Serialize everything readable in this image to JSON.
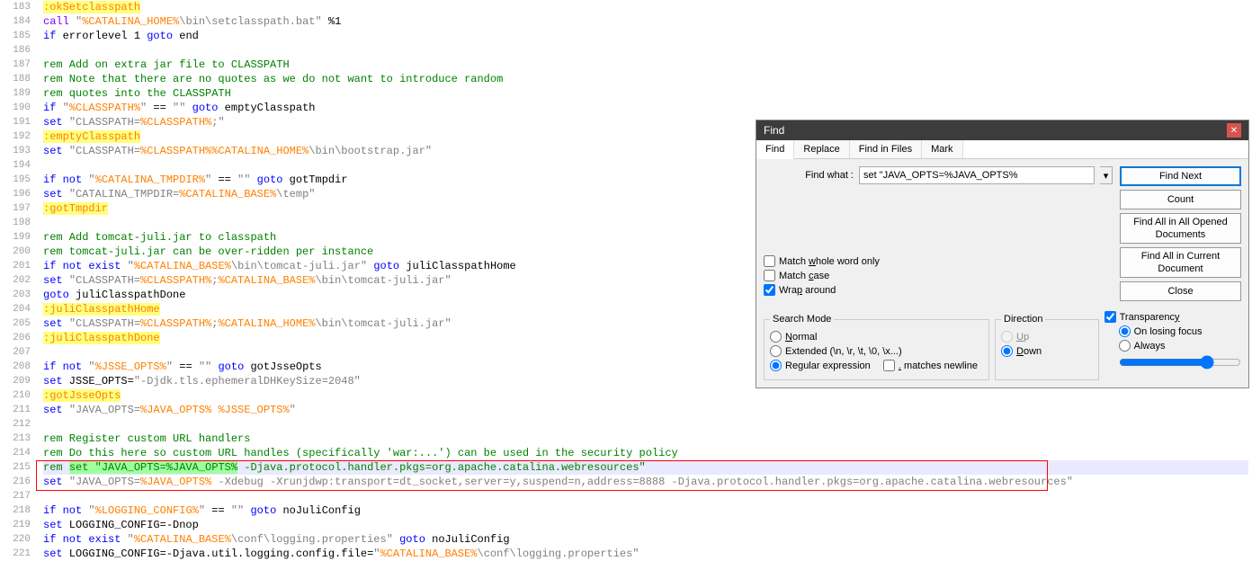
{
  "lines": {
    "183": [
      {
        "t": ":okSetclasspath",
        "c": "t-orange hl-yellow"
      }
    ],
    "184": [
      {
        "t": "call",
        "c": "t-purple"
      },
      {
        "t": " ",
        "c": ""
      },
      {
        "t": "\"",
        "c": "t-gray"
      },
      {
        "t": "%CATALINA_HOME%",
        "c": "t-orange"
      },
      {
        "t": "\\bin\\setclasspath.bat\"",
        "c": "t-gray"
      },
      {
        "t": " %1",
        "c": ""
      }
    ],
    "185": [
      {
        "t": "if",
        "c": "t-blue"
      },
      {
        "t": " errorlevel 1 ",
        "c": ""
      },
      {
        "t": "goto",
        "c": "t-blue"
      },
      {
        "t": " end",
        "c": ""
      }
    ],
    "186": [
      {
        "t": "",
        "c": ""
      }
    ],
    "187": [
      {
        "t": "rem Add on extra jar file to CLASSPATH",
        "c": "t-green"
      }
    ],
    "188": [
      {
        "t": "rem Note that there are no quotes as we do not want to introduce random",
        "c": "t-green"
      }
    ],
    "189": [
      {
        "t": "rem quotes into the CLASSPATH",
        "c": "t-green"
      }
    ],
    "190": [
      {
        "t": "if",
        "c": "t-blue"
      },
      {
        "t": " ",
        "c": ""
      },
      {
        "t": "\"",
        "c": "t-gray"
      },
      {
        "t": "%CLASSPATH%",
        "c": "t-orange"
      },
      {
        "t": "\"",
        "c": "t-gray"
      },
      {
        "t": " == ",
        "c": ""
      },
      {
        "t": "\"\"",
        "c": "t-gray"
      },
      {
        "t": " ",
        "c": ""
      },
      {
        "t": "goto",
        "c": "t-blue"
      },
      {
        "t": " emptyClasspath",
        "c": ""
      }
    ],
    "191": [
      {
        "t": "set",
        "c": "t-blue"
      },
      {
        "t": " ",
        "c": ""
      },
      {
        "t": "\"CLASSPATH=",
        "c": "t-gray"
      },
      {
        "t": "%CLASSPATH%",
        "c": "t-orange"
      },
      {
        "t": ";\"",
        "c": "t-gray"
      }
    ],
    "192": [
      {
        "t": ":emptyClasspath",
        "c": "t-orange hl-yellow"
      }
    ],
    "193": [
      {
        "t": "set",
        "c": "t-blue"
      },
      {
        "t": " ",
        "c": ""
      },
      {
        "t": "\"CLASSPATH=",
        "c": "t-gray"
      },
      {
        "t": "%CLASSPATH%%CATALINA_HOME%",
        "c": "t-orange"
      },
      {
        "t": "\\bin\\bootstrap.jar\"",
        "c": "t-gray"
      }
    ],
    "194": [
      {
        "t": "",
        "c": ""
      }
    ],
    "195": [
      {
        "t": "if",
        "c": "t-blue"
      },
      {
        "t": " ",
        "c": ""
      },
      {
        "t": "not",
        "c": "t-blue"
      },
      {
        "t": " ",
        "c": ""
      },
      {
        "t": "\"",
        "c": "t-gray"
      },
      {
        "t": "%CATALINA_TMPDIR%",
        "c": "t-orange"
      },
      {
        "t": "\"",
        "c": "t-gray"
      },
      {
        "t": " == ",
        "c": ""
      },
      {
        "t": "\"\"",
        "c": "t-gray"
      },
      {
        "t": " ",
        "c": ""
      },
      {
        "t": "goto",
        "c": "t-blue"
      },
      {
        "t": " gotTmpdir",
        "c": ""
      }
    ],
    "196": [
      {
        "t": "set",
        "c": "t-blue"
      },
      {
        "t": " ",
        "c": ""
      },
      {
        "t": "\"CATALINA_TMPDIR=",
        "c": "t-gray"
      },
      {
        "t": "%CATALINA_BASE%",
        "c": "t-orange"
      },
      {
        "t": "\\temp\"",
        "c": "t-gray"
      }
    ],
    "197": [
      {
        "t": ":gotTmpdir",
        "c": "t-orange hl-yellow"
      }
    ],
    "198": [
      {
        "t": "",
        "c": ""
      }
    ],
    "199": [
      {
        "t": "rem Add tomcat-juli.jar to classpath",
        "c": "t-green"
      }
    ],
    "200": [
      {
        "t": "rem tomcat-juli.jar can be over-ridden per instance",
        "c": "t-green"
      }
    ],
    "201": [
      {
        "t": "if",
        "c": "t-blue"
      },
      {
        "t": " ",
        "c": ""
      },
      {
        "t": "not",
        "c": "t-blue"
      },
      {
        "t": " ",
        "c": ""
      },
      {
        "t": "exist",
        "c": "t-blue"
      },
      {
        "t": " ",
        "c": ""
      },
      {
        "t": "\"",
        "c": "t-gray"
      },
      {
        "t": "%CATALINA_BASE%",
        "c": "t-orange"
      },
      {
        "t": "\\bin\\tomcat-juli.jar\"",
        "c": "t-gray"
      },
      {
        "t": " ",
        "c": ""
      },
      {
        "t": "goto",
        "c": "t-blue"
      },
      {
        "t": " juliClasspathHome",
        "c": ""
      }
    ],
    "202": [
      {
        "t": "set",
        "c": "t-blue"
      },
      {
        "t": " ",
        "c": ""
      },
      {
        "t": "\"CLASSPATH=",
        "c": "t-gray"
      },
      {
        "t": "%CLASSPATH%",
        "c": "t-orange"
      },
      {
        "t": ";",
        "c": "t-gray"
      },
      {
        "t": "%CATALINA_BASE%",
        "c": "t-orange"
      },
      {
        "t": "\\bin\\tomcat-juli.jar\"",
        "c": "t-gray"
      }
    ],
    "203": [
      {
        "t": "goto",
        "c": "t-blue"
      },
      {
        "t": " juliClasspathDone",
        "c": ""
      }
    ],
    "204": [
      {
        "t": ":juliClasspathHome",
        "c": "t-orange hl-yellow"
      }
    ],
    "205": [
      {
        "t": "set",
        "c": "t-blue"
      },
      {
        "t": " ",
        "c": ""
      },
      {
        "t": "\"CLASSPATH=",
        "c": "t-gray"
      },
      {
        "t": "%CLASSPATH%",
        "c": "t-orange"
      },
      {
        "t": ";",
        "c": "t-gray"
      },
      {
        "t": "%CATALINA_HOME%",
        "c": "t-orange"
      },
      {
        "t": "\\bin\\tomcat-juli.jar\"",
        "c": "t-gray"
      }
    ],
    "206": [
      {
        "t": ":juliClasspathDone",
        "c": "t-orange hl-yellow"
      }
    ],
    "207": [
      {
        "t": "",
        "c": ""
      }
    ],
    "208": [
      {
        "t": "if",
        "c": "t-blue"
      },
      {
        "t": " ",
        "c": ""
      },
      {
        "t": "not",
        "c": "t-blue"
      },
      {
        "t": " ",
        "c": ""
      },
      {
        "t": "\"",
        "c": "t-gray"
      },
      {
        "t": "%JSSE_OPTS%",
        "c": "t-orange"
      },
      {
        "t": "\"",
        "c": "t-gray"
      },
      {
        "t": " == ",
        "c": ""
      },
      {
        "t": "\"\"",
        "c": "t-gray"
      },
      {
        "t": " ",
        "c": ""
      },
      {
        "t": "goto",
        "c": "t-blue"
      },
      {
        "t": " gotJsseOpts",
        "c": ""
      }
    ],
    "209": [
      {
        "t": "set",
        "c": "t-blue"
      },
      {
        "t": " JSSE_OPTS=",
        "c": ""
      },
      {
        "t": "\"-Djdk.tls.ephemeralDHKeySize=2048\"",
        "c": "t-gray"
      }
    ],
    "210": [
      {
        "t": ":gotJsseOpts",
        "c": "t-orange hl-yellow"
      }
    ],
    "211": [
      {
        "t": "set",
        "c": "t-blue"
      },
      {
        "t": " ",
        "c": ""
      },
      {
        "t": "\"JAVA_OPTS=",
        "c": "t-gray"
      },
      {
        "t": "%JAVA_OPTS% %JSSE_OPTS%",
        "c": "t-orange"
      },
      {
        "t": "\"",
        "c": "t-gray"
      }
    ],
    "212": [
      {
        "t": "",
        "c": ""
      }
    ],
    "213": [
      {
        "t": "rem Register custom URL handlers",
        "c": "t-green"
      }
    ],
    "214": [
      {
        "t": "rem Do this here so custom URL handles (specifically 'war:...') can be used in the security policy",
        "c": "t-green"
      }
    ],
    "215": [
      {
        "t": "rem ",
        "c": "t-green"
      },
      {
        "t": "set \"JAVA_OPTS=%JAVA_OPTS%",
        "c": "t-green hl-green"
      },
      {
        "t": " -Djava.protocol.handler.pkgs=org.apache.catalina.webresources\"",
        "c": "t-green"
      }
    ],
    "216": [
      {
        "t": "set",
        "c": "t-blue"
      },
      {
        "t": " ",
        "c": ""
      },
      {
        "t": "\"JAVA_OPTS=",
        "c": "t-gray"
      },
      {
        "t": "%JAVA_OPTS%",
        "c": "t-orange"
      },
      {
        "t": " -Xdebug -Xrunjdwp:transport=dt_socket,server=y,suspend=n,address=8888 -Djava.protocol.handler.pkgs=org.apache.catalina.webresources\"",
        "c": "t-gray"
      }
    ],
    "217": [
      {
        "t": "",
        "c": ""
      }
    ],
    "218": [
      {
        "t": "if",
        "c": "t-blue"
      },
      {
        "t": " ",
        "c": ""
      },
      {
        "t": "not",
        "c": "t-blue"
      },
      {
        "t": " ",
        "c": ""
      },
      {
        "t": "\"",
        "c": "t-gray"
      },
      {
        "t": "%LOGGING_CONFIG%",
        "c": "t-orange"
      },
      {
        "t": "\"",
        "c": "t-gray"
      },
      {
        "t": " == ",
        "c": ""
      },
      {
        "t": "\"\"",
        "c": "t-gray"
      },
      {
        "t": " ",
        "c": ""
      },
      {
        "t": "goto",
        "c": "t-blue"
      },
      {
        "t": " noJuliConfig",
        "c": ""
      }
    ],
    "219": [
      {
        "t": "set",
        "c": "t-blue"
      },
      {
        "t": " LOGGING_CONFIG=-Dnop",
        "c": ""
      }
    ],
    "220": [
      {
        "t": "if",
        "c": "t-blue"
      },
      {
        "t": " ",
        "c": ""
      },
      {
        "t": "not",
        "c": "t-blue"
      },
      {
        "t": " ",
        "c": ""
      },
      {
        "t": "exist",
        "c": "t-blue"
      },
      {
        "t": " ",
        "c": ""
      },
      {
        "t": "\"",
        "c": "t-gray"
      },
      {
        "t": "%CATALINA_BASE%",
        "c": "t-orange"
      },
      {
        "t": "\\conf\\logging.properties\"",
        "c": "t-gray"
      },
      {
        "t": " ",
        "c": ""
      },
      {
        "t": "goto",
        "c": "t-blue"
      },
      {
        "t": " noJuliConfig",
        "c": ""
      }
    ],
    "221": [
      {
        "t": "set",
        "c": "t-blue"
      },
      {
        "t": " LOGGING_CONFIG=-Djava.util.logging.config.file=",
        "c": ""
      },
      {
        "t": "\"",
        "c": "t-gray"
      },
      {
        "t": "%CATALINA_BASE%",
        "c": "t-orange"
      },
      {
        "t": "\\conf\\logging.properties\"",
        "c": "t-gray"
      }
    ]
  },
  "start": 183,
  "end": 221,
  "hl_line": 215,
  "find": {
    "title": "Find",
    "tabs": {
      "find": "Find",
      "replace": "Replace",
      "fif": "Find in Files",
      "mark": "Mark"
    },
    "what_label": "Find what :",
    "what_value": "set \"JAVA_OPTS=%JAVA_OPTS%",
    "btn_find_next": "Find Next",
    "btn_count": "Count",
    "btn_find_all_open": "Find All in All Opened Documents",
    "btn_find_all_cur": "Find All in Current Document",
    "btn_close": "Close",
    "chk_whole": "Match whole word only",
    "chk_case": "Match case",
    "chk_wrap": "Wrap around",
    "grp_mode": "Search Mode",
    "opt_normal": "Normal",
    "opt_ext": "Extended (\\n, \\r, \\t, \\0, \\x...)",
    "opt_regex": "Regular expression",
    "chk_dotnl": ". matches newline",
    "grp_dir": "Direction",
    "opt_up": "Up",
    "opt_down": "Down",
    "chk_trans": "Transparency",
    "opt_focus": "On losing focus",
    "opt_always": "Always"
  }
}
